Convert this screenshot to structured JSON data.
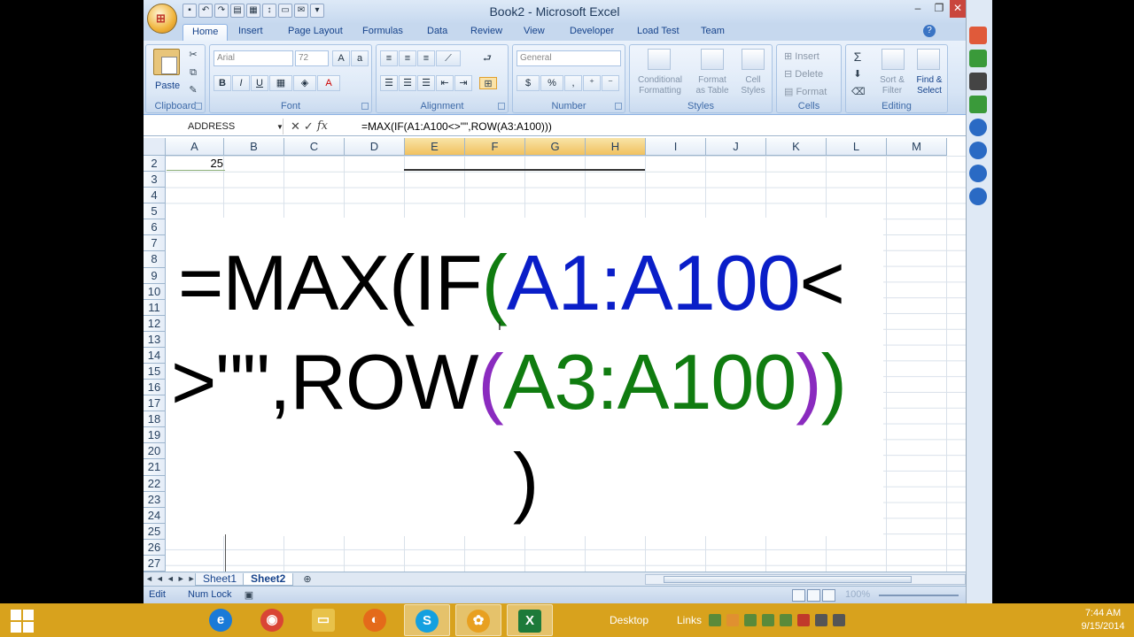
{
  "window": {
    "title": "Book2 - Microsoft Excel",
    "min": "0",
    "max": "1",
    "close": "r"
  },
  "tabs": [
    "Home",
    "Insert",
    "Page Layout",
    "Formulas",
    "Data",
    "Review",
    "View",
    "Developer",
    "Load Test",
    "Team"
  ],
  "ribbon": {
    "clipboard": {
      "label": "Clipboard",
      "paste": "Paste"
    },
    "font": {
      "label": "Font",
      "name": "Arial",
      "size": "72"
    },
    "alignment": {
      "label": "Alignment"
    },
    "number": {
      "label": "Number",
      "format": "General"
    },
    "styles": {
      "label": "Styles",
      "conditional": "Conditional\nFormatting",
      "format_table": "Format\nas Table",
      "cell_styles": "Cell\nStyles"
    },
    "cells": {
      "label": "Cells",
      "insert": "Insert",
      "delete": "Delete",
      "format": "Format"
    },
    "editing": {
      "label": "Editing",
      "sort": "Sort &\nFilter",
      "find": "Find &\nSelect"
    }
  },
  "formula_bar": {
    "name_box": "ADDRESS",
    "formula": "=MAX(IF(A1:A100<>\"\",ROW(A3:A100)))"
  },
  "columns": [
    "A",
    "B",
    "C",
    "D",
    "E",
    "F",
    "G",
    "H",
    "I",
    "J",
    "K",
    "L",
    "M"
  ],
  "rows": [
    "2",
    "3",
    "4",
    "5",
    "6",
    "7",
    "8",
    "9",
    "10",
    "11",
    "12",
    "13",
    "14",
    "15",
    "16",
    "17",
    "18",
    "19",
    "20",
    "21",
    "22",
    "23",
    "24",
    "25",
    "26",
    "27"
  ],
  "cells": {
    "A2": "25"
  },
  "overlay": {
    "line1": [
      {
        "t": "=MAX(IF",
        "c": "k"
      },
      {
        "t": "(",
        "c": "g"
      },
      {
        "t": "A1:A100",
        "c": "bl"
      },
      {
        "t": "<",
        "c": "k"
      }
    ],
    "line2": [
      {
        "t": ">\"\",ROW",
        "c": "k"
      },
      {
        "t": "(",
        "c": "p"
      },
      {
        "t": "A3:A100",
        "c": "g"
      },
      {
        "t": ")",
        "c": "p"
      },
      {
        "t": ")",
        "c": "g"
      }
    ],
    "line3": [
      {
        "t": ")",
        "c": "k"
      }
    ]
  },
  "sheets": [
    "Sheet1",
    "Sheet2"
  ],
  "active_sheet": "Sheet2",
  "status": {
    "mode": "Edit",
    "numlock": "Num Lock",
    "zoom": "100%"
  },
  "taskbar": {
    "desktop": "Desktop",
    "links": "Links",
    "time": "7:44 AM",
    "date": "9/15/2014"
  },
  "colors": {
    "accent": "#d8a21d",
    "green": "#107c10",
    "blue": "#0a1ec8",
    "purple": "#8a2bbf"
  }
}
